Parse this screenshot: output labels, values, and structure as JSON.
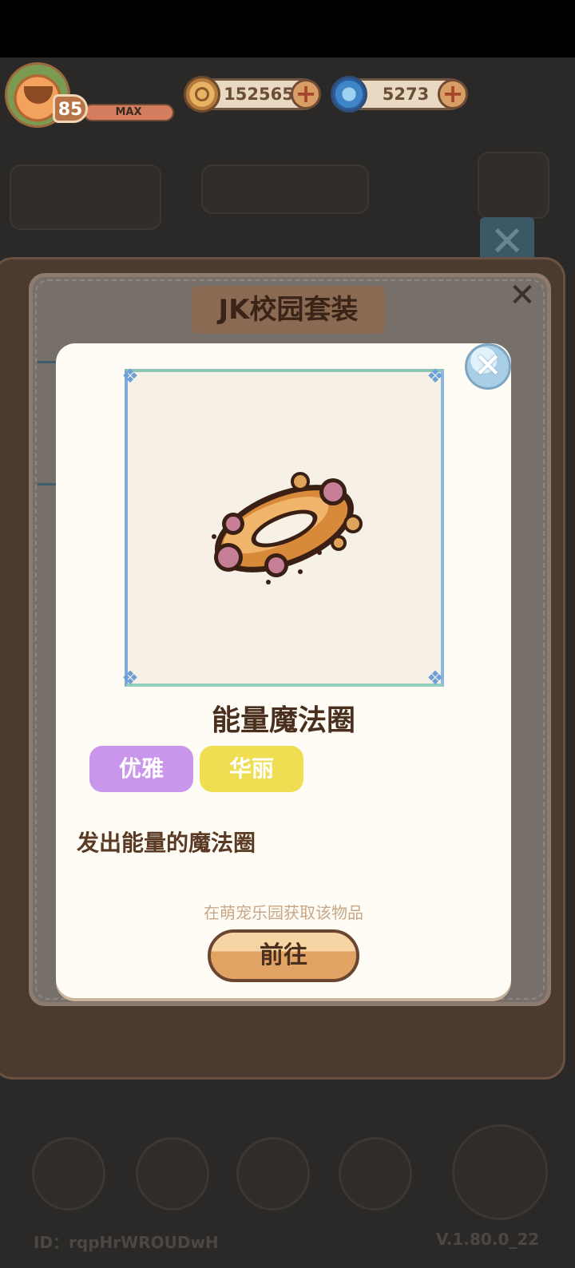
{
  "player": {
    "level": "85",
    "level_status": "MAX"
  },
  "currency": {
    "coins": "152565",
    "gems": "5273",
    "add_symbol": "+"
  },
  "collection": {
    "title": "JK校园套装",
    "close_symbol": "✕"
  },
  "item": {
    "name": "能量魔法圈",
    "tags": [
      "优雅",
      "华丽"
    ],
    "tag_colors": [
      "#c996ec",
      "#efdd52"
    ],
    "description": "发出能量的魔法圈",
    "source_hint": "在萌宠乐园获取该物品",
    "go_button": "前往",
    "close_symbol": "✕"
  },
  "footer": {
    "id": "ID：rqpHrWROUDwH",
    "version": "V.1.80.0_22"
  }
}
